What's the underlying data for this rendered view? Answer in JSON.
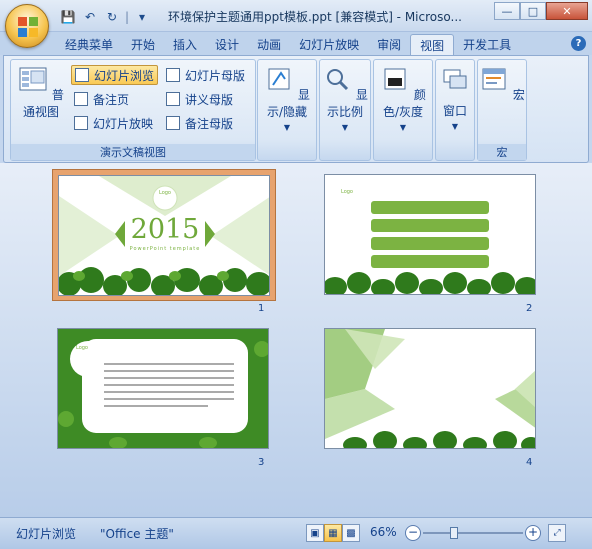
{
  "window": {
    "title": "环境保护主题通用ppt模板.ppt [兼容模式] - Microso...",
    "controls": [
      "minimize",
      "maximize",
      "close"
    ]
  },
  "qat": {
    "icons": [
      "save-icon",
      "undo-icon",
      "redo-icon",
      "customize-icon"
    ]
  },
  "tabs": [
    {
      "label": "经典菜单"
    },
    {
      "label": "开始"
    },
    {
      "label": "插入"
    },
    {
      "label": "设计"
    },
    {
      "label": "动画"
    },
    {
      "label": "幻灯片放映"
    },
    {
      "label": "审阅"
    },
    {
      "label": "视图",
      "active": true
    },
    {
      "label": "开发工具"
    }
  ],
  "ribbon": {
    "presentation_views": {
      "label": "演示文稿视图",
      "normal": "普通视图",
      "sorter": "幻灯片浏览",
      "notes": "备注页",
      "reading": "幻灯片放映",
      "slide_master": "幻灯片母版",
      "handout_master": "讲义母版",
      "notes_master": "备注母版"
    },
    "show_hide": "显示/隐藏",
    "zoom": "显示比例",
    "color": "颜色/灰度",
    "window": "窗口",
    "macros": {
      "button": "宏",
      "label": "宏"
    }
  },
  "slides": [
    {
      "number": "1",
      "logo": "Logo",
      "year": "2015",
      "subtitle": "PowerPoint template"
    },
    {
      "number": "2",
      "logo": "Logo"
    },
    {
      "number": "3",
      "logo": "Logo"
    },
    {
      "number": "4"
    }
  ],
  "status": {
    "view": "幻灯片浏览",
    "theme": "\"Office 主题\"",
    "zoom": "66%",
    "zoom_fraction": 0.66
  },
  "colors": {
    "accent_green": "#7cb342",
    "selection": "#e7a36e",
    "ribbon_text": "#15428b"
  }
}
